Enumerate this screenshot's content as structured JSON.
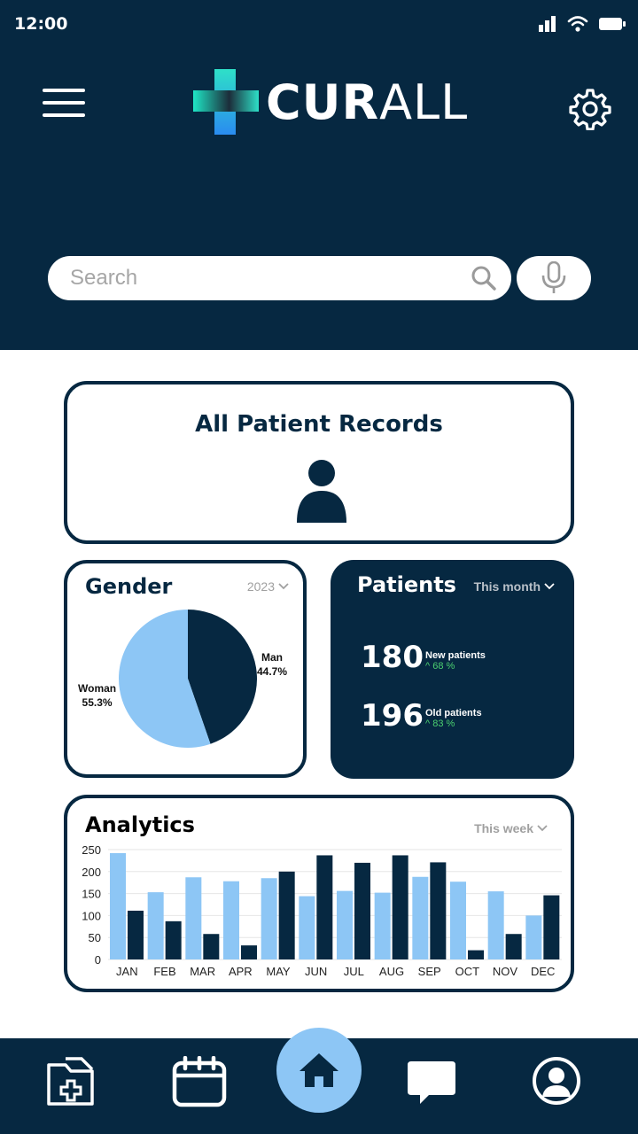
{
  "status": {
    "time": "12:00"
  },
  "header": {
    "logo_bold": "CUR",
    "logo_thin": "ALL"
  },
  "search": {
    "placeholder": "Search"
  },
  "records": {
    "title": "All Patient Records"
  },
  "gender": {
    "title": "Gender",
    "filter": "2023",
    "man_label": "Man",
    "man_pct": "44.7%",
    "woman_label": "Woman",
    "woman_pct": "55.3%"
  },
  "patients": {
    "title": "Patients",
    "filter": "This month",
    "new_count": "180",
    "new_label": "New patients",
    "new_pct": "^ 68 %",
    "old_count": "196",
    "old_label": "Old patients",
    "old_pct": "^ 83 %"
  },
  "analytics": {
    "title": "Analytics",
    "filter": "This week"
  },
  "colors": {
    "navy": "#062841",
    "light_blue": "#8dc6f5",
    "green": "#4cd070"
  },
  "chart_data": [
    {
      "type": "pie",
      "categories": [
        "Man",
        "Woman"
      ],
      "values": [
        44.7,
        55.3
      ],
      "title": "Gender"
    },
    {
      "type": "bar",
      "title": "Analytics",
      "categories": [
        "JAN",
        "FEB",
        "MAR",
        "APR",
        "MAY",
        "JUN",
        "JUL",
        "AUG",
        "SEP",
        "OCT",
        "NOV",
        "DEC"
      ],
      "series": [
        {
          "values": [
            242,
            153,
            187,
            178,
            185,
            144,
            156,
            152,
            188,
            177,
            155,
            100
          ]
        },
        {
          "values": [
            111,
            87,
            58,
            32,
            200,
            237,
            220,
            237,
            221,
            21,
            58,
            146
          ]
        }
      ],
      "ylim": [
        0,
        250
      ],
      "yticks": [
        0,
        50,
        100,
        150,
        200,
        250
      ],
      "grid": true
    }
  ]
}
